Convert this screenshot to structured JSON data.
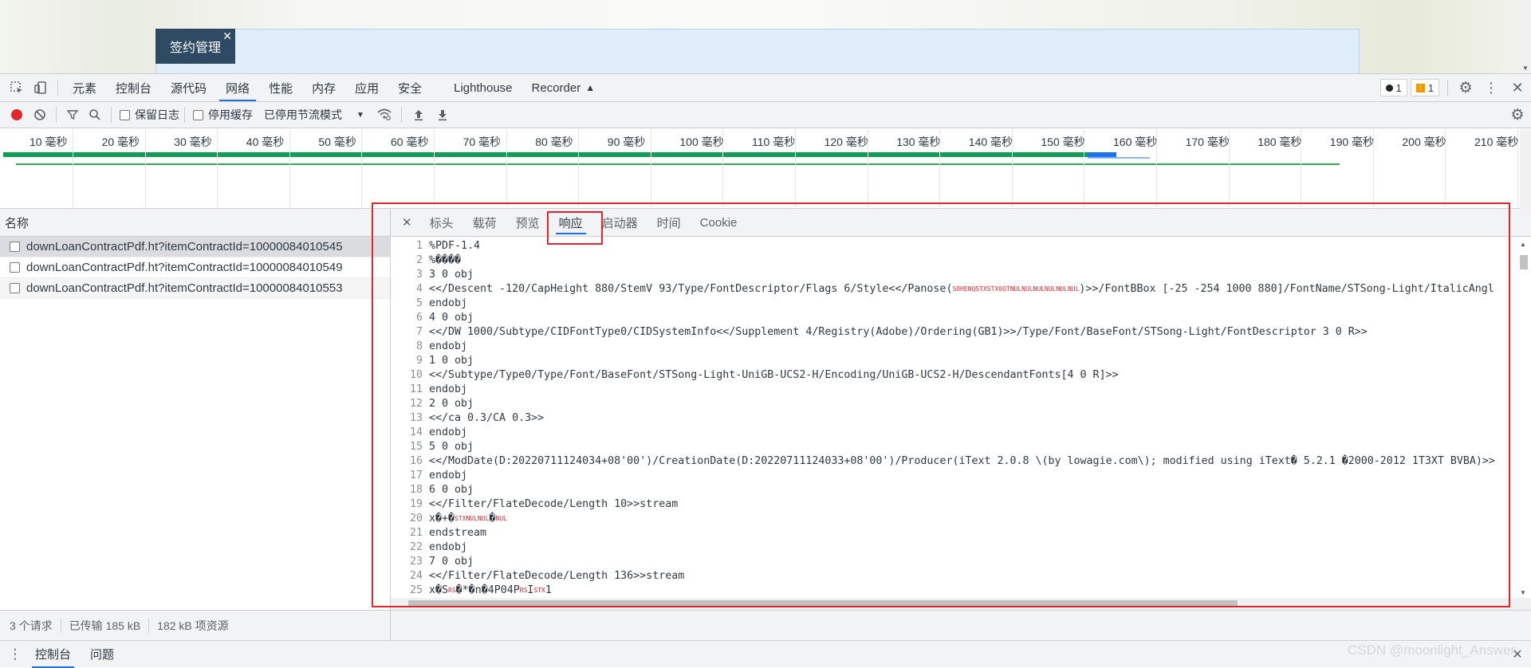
{
  "page": {
    "tab_label": "签约管理",
    "tab_close": "✕"
  },
  "devtools": {
    "main_tabs": [
      "元素",
      "控制台",
      "源代码",
      "网络",
      "性能",
      "内存",
      "应用",
      "安全",
      "Lighthouse",
      "Recorder"
    ],
    "active_tab": "网络",
    "errors_count": "1",
    "warnings_count": "1"
  },
  "network_toolbar": {
    "preserve_log_label": "保留日志",
    "disable_cache_label": "停用缓存",
    "throttle_label": "已停用节流模式"
  },
  "timeline": {
    "ticks": [
      "10 毫秒",
      "20 毫秒",
      "30 毫秒",
      "40 毫秒",
      "50 毫秒",
      "60 毫秒",
      "70 毫秒",
      "80 毫秒",
      "90 毫秒",
      "100 毫秒",
      "110 毫秒",
      "120 毫秒",
      "130 毫秒",
      "140 毫秒",
      "150 毫秒",
      "160 毫秒",
      "170 毫秒",
      "180 毫秒",
      "190 毫秒",
      "200 毫秒",
      "210 毫秒"
    ]
  },
  "requests": {
    "header": "名称",
    "items": [
      "downLoanContractPdf.ht?itemContractId=10000084010545",
      "downLoanContractPdf.ht?itemContractId=10000084010549",
      "downLoanContractPdf.ht?itemContractId=10000084010553"
    ]
  },
  "detail": {
    "close": "✕",
    "tabs": [
      "标头",
      "载荷",
      "预览",
      "响应",
      "启动器",
      "时间",
      "Cookie"
    ],
    "active_tab": "响应",
    "lines": [
      {
        "n": "1",
        "t": "%PDF-1.4"
      },
      {
        "n": "2",
        "t": "%����"
      },
      {
        "n": "3",
        "t": "3 0 obj"
      },
      {
        "n": "4",
        "t": "<</Descent -120/CapHeight 880/StemV 93/Type/FontDescriptor/Flags 6/Style<</Panose(",
        "ctrl": "SOHENQSTXSTX0OTNULNULNULNULNULNUL",
        "t2": ")>>/FontBBox [-25 -254 1000 880]/FontName/STSong-Light/ItalicAngl"
      },
      {
        "n": "5",
        "t": "endobj"
      },
      {
        "n": "6",
        "t": "4 0 obj"
      },
      {
        "n": "7",
        "t": "<</DW 1000/Subtype/CIDFontType0/CIDSystemInfo<</Supplement 4/Registry(Adobe)/Ordering(GB1)>>/Type/Font/BaseFont/STSong-Light/FontDescriptor 3 0 R>>"
      },
      {
        "n": "8",
        "t": "endobj"
      },
      {
        "n": "9",
        "t": "1 0 obj"
      },
      {
        "n": "10",
        "t": "<</Subtype/Type0/Type/Font/BaseFont/STSong-Light-UniGB-UCS2-H/Encoding/UniGB-UCS2-H/DescendantFonts[4 0 R]>>"
      },
      {
        "n": "11",
        "t": "endobj"
      },
      {
        "n": "12",
        "t": "2 0 obj"
      },
      {
        "n": "13",
        "t": "<</ca 0.3/CA 0.3>>"
      },
      {
        "n": "14",
        "t": "endobj"
      },
      {
        "n": "15",
        "t": "5 0 obj"
      },
      {
        "n": "16",
        "t": "<</ModDate(D:20220711124034+08'00')/CreationDate(D:20220711124033+08'00')/Producer(iText 2.0.8 \\(by lowagie.com\\); modified using iText� 5.2.1 �2000-2012 1T3XT BVBA)>>"
      },
      {
        "n": "17",
        "t": "endobj"
      },
      {
        "n": "18",
        "t": "6 0 obj"
      },
      {
        "n": "19",
        "t": "<</Filter/FlateDecode/Length 10>>stream"
      },
      {
        "n": "20",
        "t": "x�+�",
        "ctrl": "STXNULNUL",
        "t2": "�",
        "ctrl2": "NUL"
      },
      {
        "n": "21",
        "t": "endstream"
      },
      {
        "n": "22",
        "t": "endobj"
      },
      {
        "n": "23",
        "t": "7 0 obj"
      },
      {
        "n": "24",
        "t": "<</Filter/FlateDecode/Length 136>>stream"
      },
      {
        "n": "25",
        "t": "x�S",
        "ctrl": "RS",
        "t2": "�*�n�4P04P",
        "ctrl2": "RS",
        "t3": "I",
        "ctrl3": "STX",
        "t4": "1"
      }
    ]
  },
  "status": {
    "requests": "3 个请求",
    "transferred": "已传输 185 kB",
    "resources": "182 kB 项资源"
  },
  "drawer": {
    "tabs": [
      "控制台",
      "问题"
    ],
    "active_tab": "控制台",
    "close": "✕"
  },
  "watermark": "CSDN @moonlight_Answer"
}
